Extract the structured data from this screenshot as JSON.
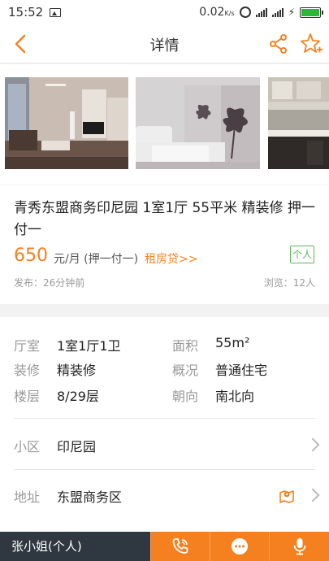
{
  "status_bar": {
    "time": "15:52",
    "speed": "0.02",
    "speed_unit": "K/s"
  },
  "nav": {
    "title": "详情"
  },
  "listing": {
    "title": "青秀东盟商务印尼园 1室1厅 55平米 精装修 押一付一",
    "price": "650",
    "price_unit": "元/月 (押一付一)",
    "loan_link": "租房贷>>",
    "owner_tag": "个人",
    "posted": "发布：26分钟前",
    "views": "浏览：12人"
  },
  "details": {
    "layout_label": "厅室",
    "layout_value": "1室1厅1卫",
    "area_label": "面积",
    "area_value": "55m²",
    "decor_label": "装修",
    "decor_value": "精装修",
    "type_label": "概况",
    "type_value": "普通住宅",
    "floor_label": "楼层",
    "floor_value": "8/29层",
    "facing_label": "朝向",
    "facing_value": "南北向",
    "community_label": "小区",
    "community_value": "印尼园",
    "address_label": "地址",
    "address_value": "东盟商务区"
  },
  "bottom_bar": {
    "contact": "张小姐(个人)"
  },
  "colors": {
    "accent": "#f5801f",
    "tag_green": "#5cb85c",
    "bottom_dark": "#2f3740"
  }
}
